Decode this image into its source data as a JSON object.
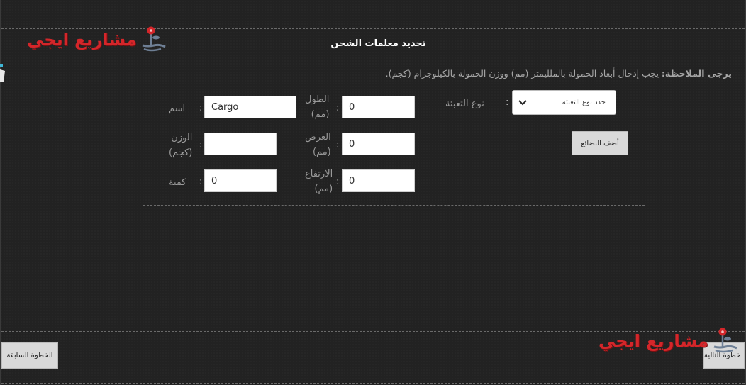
{
  "header": {
    "logo_text": "مشاريع ايجي",
    "title": "تحديد معلمات الشحن"
  },
  "note": {
    "label": "يرجى الملاحظة:",
    "text": "يجب إدخال أبعاد الحمولة بالملليمتر (مم) ووزن الحمولة بالكيلوجرام (كجم)."
  },
  "form": {
    "name_label": "اسم",
    "name_value": "Cargo",
    "weight_label_line1": "الوزن",
    "weight_label_line2": "(كجم)",
    "weight_value": "",
    "quantity_label": "كمية",
    "quantity_value": "0",
    "length_label_line1": "الطول",
    "length_label_line2": "(مم)",
    "length_value": "0",
    "width_label_line1": "العرض",
    "width_label_line2": "(مم)",
    "width_value": "0",
    "height_label_line1": "الارتفاع",
    "height_label_line2": "(مم)",
    "height_value": "0",
    "packaging_label": "نوع التعبئة",
    "packaging_selected": "حدد نوع التعبئة",
    "colon": ":",
    "add_goods_button": "أضف البضائع"
  },
  "footer": {
    "prev_button": "الخطوة السابقة",
    "next_button": "خطوة التالية",
    "logo_text": "مشاريع ايجي"
  },
  "colors": {
    "background": "#222222",
    "logo_red": "#d4262a",
    "button_bg": "#d9d9d9"
  }
}
